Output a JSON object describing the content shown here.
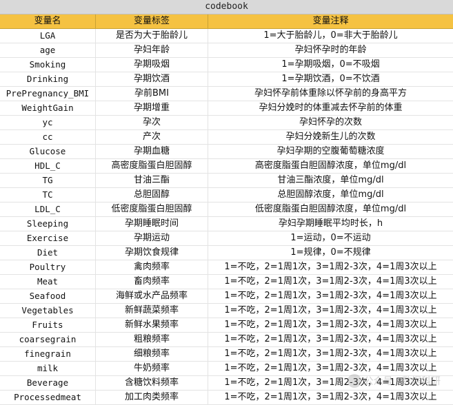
{
  "title": "codebook",
  "headers": [
    "变量名",
    "变量标签",
    "变量注释"
  ],
  "rows": [
    [
      "LGA",
      "是否为大于胎龄儿",
      "1=大于胎龄儿，0=非大于胎龄儿"
    ],
    [
      "age",
      "孕妇年龄",
      "孕妇怀孕时的年龄"
    ],
    [
      "Smoking",
      "孕期吸烟",
      "1=孕期吸烟，0=不吸烟"
    ],
    [
      "Drinking",
      "孕期饮酒",
      "1=孕期饮酒，0=不饮酒"
    ],
    [
      "PrePregnancy_BMI",
      "孕前BMI",
      "孕妇怀孕前体重除以怀孕前的身高平方"
    ],
    [
      "WeightGain",
      "孕期增重",
      "孕妇分娩时的体重减去怀孕前的体重"
    ],
    [
      "yc",
      "孕次",
      "孕妇怀孕的次数"
    ],
    [
      "cc",
      "产次",
      "孕妇分娩新生儿的次数"
    ],
    [
      "Glucose",
      "孕期血糖",
      "孕妇孕期的空腹葡萄糖浓度"
    ],
    [
      "HDL_C",
      "高密度脂蛋白胆固醇",
      "高密度脂蛋白胆固醇浓度，单位mg/dl"
    ],
    [
      "TG",
      "甘油三酯",
      "甘油三酯浓度，单位mg/dl"
    ],
    [
      "TC",
      "总胆固醇",
      "总胆固醇浓度，单位mg/dl"
    ],
    [
      "LDL_C",
      "低密度脂蛋白胆固醇",
      "低密度脂蛋白胆固醇浓度，单位mg/dl"
    ],
    [
      "Sleeping",
      "孕期睡眠时间",
      "孕妇孕期睡眠平均时长，h"
    ],
    [
      "Exercise",
      "孕期运动",
      "1=运动，0=不运动"
    ],
    [
      "Diet",
      "孕期饮食规律",
      "1=规律，0=不规律"
    ],
    [
      "Poultry",
      "禽肉频率",
      "1=不吃，2=1周1次，3=1周2-3次，4=1周3次以上"
    ],
    [
      "Meat",
      "畜肉频率",
      "1=不吃，2=1周1次，3=1周2-3次，4=1周3次以上"
    ],
    [
      "Seafood",
      "海鲜或水产品频率",
      "1=不吃，2=1周1次，3=1周2-3次，4=1周3次以上"
    ],
    [
      "Vegetables",
      "新鲜蔬菜频率",
      "1=不吃，2=1周1次，3=1周2-3次，4=1周3次以上"
    ],
    [
      "Fruits",
      "新鲜水果频率",
      "1=不吃，2=1周1次，3=1周2-3次，4=1周3次以上"
    ],
    [
      "coarsegrain",
      "粗粮频率",
      "1=不吃，2=1周1次，3=1周2-3次，4=1周3次以上"
    ],
    [
      "finegrain",
      "细粮频率",
      "1=不吃，2=1周1次，3=1周2-3次，4=1周3次以上"
    ],
    [
      "milk",
      "牛奶频率",
      "1=不吃，2=1周1次，3=1周2-3次，4=1周3次以上"
    ],
    [
      "Beverage",
      "含糖饮料频率",
      "1=不吃，2=1周1次，3=1周2-3次，4=1周3次以上"
    ],
    [
      "Processedmeat",
      "加工肉类频率",
      "1=不吃，2=1周1次，3=1周2-3次，4=1周3次以上"
    ]
  ],
  "watermark": "公众号 · 数据科研"
}
